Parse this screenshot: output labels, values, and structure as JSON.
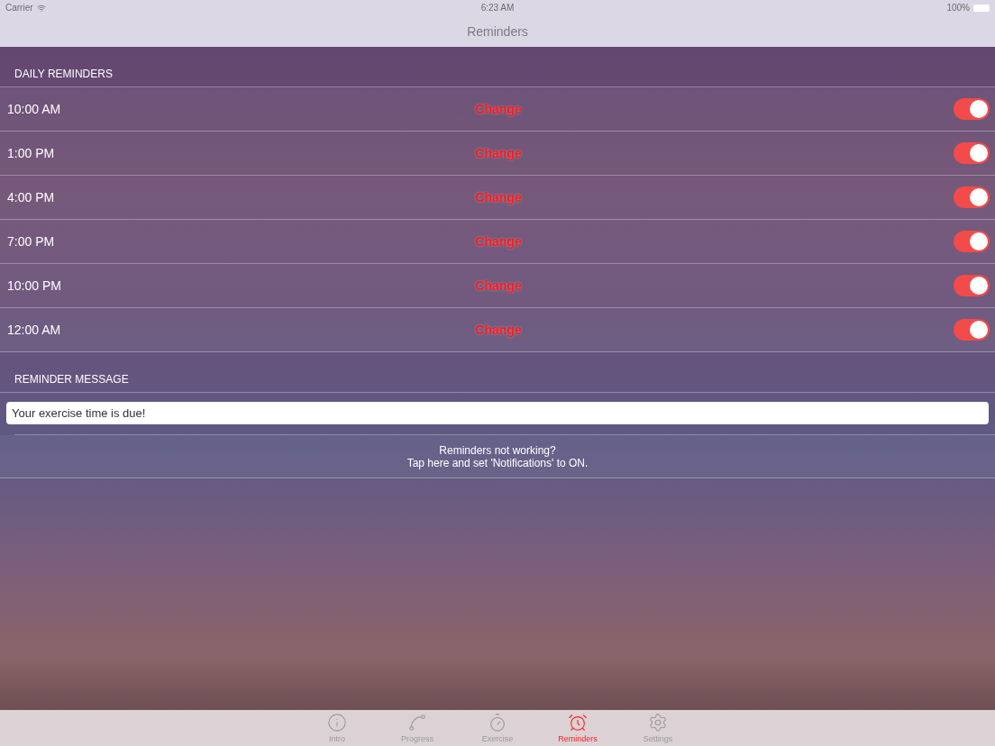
{
  "status_bar": {
    "carrier": "Carrier",
    "time": "6:23 AM",
    "battery": "100%"
  },
  "nav": {
    "title": "Reminders"
  },
  "daily": {
    "header": "DAILY REMINDERS",
    "rows": [
      {
        "time": "10:00 AM",
        "action": "Change",
        "on": true
      },
      {
        "time": "1:00 PM",
        "action": "Change",
        "on": true
      },
      {
        "time": "4:00 PM",
        "action": "Change",
        "on": true
      },
      {
        "time": "7:00 PM",
        "action": "Change",
        "on": true
      },
      {
        "time": "10:00 PM",
        "action": "Change",
        "on": true
      },
      {
        "time": "12:00 AM",
        "action": "Change",
        "on": true
      }
    ]
  },
  "message": {
    "header": "REMINDER MESSAGE",
    "value": "Your exercise time is due!",
    "help": [
      "Reminders not working?",
      "Tap here and set 'Notifications' to ON."
    ]
  },
  "tabs": [
    {
      "label": "Intro",
      "selected": false
    },
    {
      "label": "Progress",
      "selected": false
    },
    {
      "label": "Exercise",
      "selected": false
    },
    {
      "label": "Reminders",
      "selected": true
    },
    {
      "label": "Settings",
      "selected": false
    }
  ]
}
